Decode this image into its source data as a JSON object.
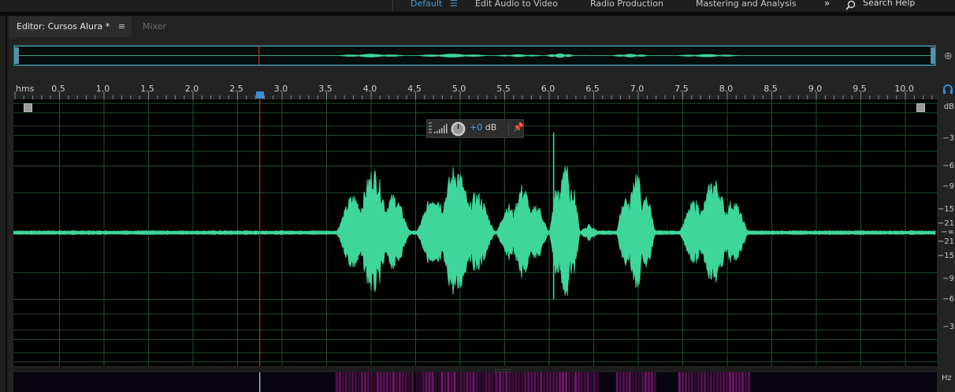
{
  "workspaces": {
    "items": [
      "Default",
      "Edit Audio to Video",
      "Radio Production",
      "Mastering and Analysis"
    ],
    "active": "Default",
    "more_icon": "double-chevron-right-icon",
    "search_label": "Search Help"
  },
  "tabs": {
    "editor_label": "Editor: Cursos Alura *",
    "editor_menu_icon": "hamburger-icon",
    "mixer_label": "Mixer"
  },
  "ruler": {
    "unit": "hms",
    "ticks": [
      "0.5",
      "1.0",
      "1.5",
      "2.0",
      "2.5",
      "3.0",
      "3.5",
      "4.0",
      "4.5",
      "5.0",
      "5.5",
      "6.0",
      "6.5",
      "7.0",
      "7.5",
      "8.0",
      "8.5",
      "9.0",
      "9.5",
      "10.0"
    ],
    "playhead_seconds": 2.75
  },
  "hud": {
    "value": "+0",
    "unit": "dB"
  },
  "db_scale": {
    "unit": "dB",
    "labels": [
      "−3",
      "−6",
      "−9",
      "−15",
      "−21",
      "−∞",
      "−21",
      "−15",
      "−9",
      "−6",
      "−3"
    ]
  },
  "spectral": {
    "unit": "Hz"
  },
  "colors": {
    "waveform": "#3ed69a",
    "playhead": "#e0332b",
    "accent": "#4a9ad8",
    "grid": "#1d4f2e",
    "background": "#000000"
  },
  "waveform": {
    "duration_seconds": 10.4,
    "segments": [
      {
        "start": 3.6,
        "end": 4.45,
        "peak": 0.4
      },
      {
        "start": 4.5,
        "end": 5.4,
        "peak": 0.42
      },
      {
        "start": 5.4,
        "end": 6.0,
        "peak": 0.3
      },
      {
        "start": 6.0,
        "end": 6.35,
        "peak": 0.5
      },
      {
        "start": 6.35,
        "end": 6.55,
        "peak": 0.06
      },
      {
        "start": 6.75,
        "end": 7.2,
        "peak": 0.4
      },
      {
        "start": 7.45,
        "end": 8.25,
        "peak": 0.34
      }
    ]
  }
}
